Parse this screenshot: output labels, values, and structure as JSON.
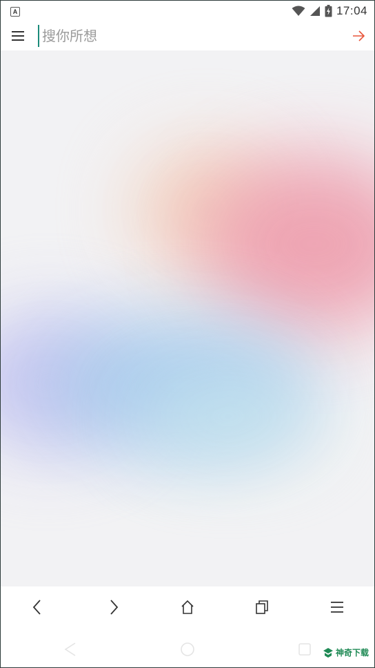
{
  "status_bar": {
    "notification_icon": "a-letter-icon",
    "notification_letter": "A",
    "icons": [
      "wifi-icon",
      "cellular-signal-icon",
      "battery-charging-icon"
    ],
    "time": "17:04"
  },
  "search": {
    "placeholder": "搜你所想",
    "value": "",
    "menu_icon": "hamburger-menu-icon",
    "go_icon": "arrow-right-icon",
    "accent_color": "#e8553a",
    "cursor_color": "#1b8b7a"
  },
  "toolbar": {
    "buttons": [
      {
        "name": "back-button",
        "icon": "chevron-left-icon"
      },
      {
        "name": "forward-button",
        "icon": "chevron-right-icon"
      },
      {
        "name": "home-button",
        "icon": "home-icon"
      },
      {
        "name": "tabs-button",
        "icon": "tabs-icon"
      },
      {
        "name": "menu-button",
        "icon": "hamburger-menu-icon"
      }
    ]
  },
  "system_nav": {
    "buttons": [
      "back-triangle-icon",
      "home-circle-icon",
      "recents-square-icon"
    ]
  },
  "watermark": {
    "text": "神奇下载",
    "icon": "shenqi-logo-icon"
  },
  "colors": {
    "background": "#f2f2f4",
    "blob_pink": "#eea2b0",
    "blob_blue": "#a8c8ec",
    "blob_peach": "#f2cbb8",
    "blob_lavender": "#c6c4f0"
  }
}
